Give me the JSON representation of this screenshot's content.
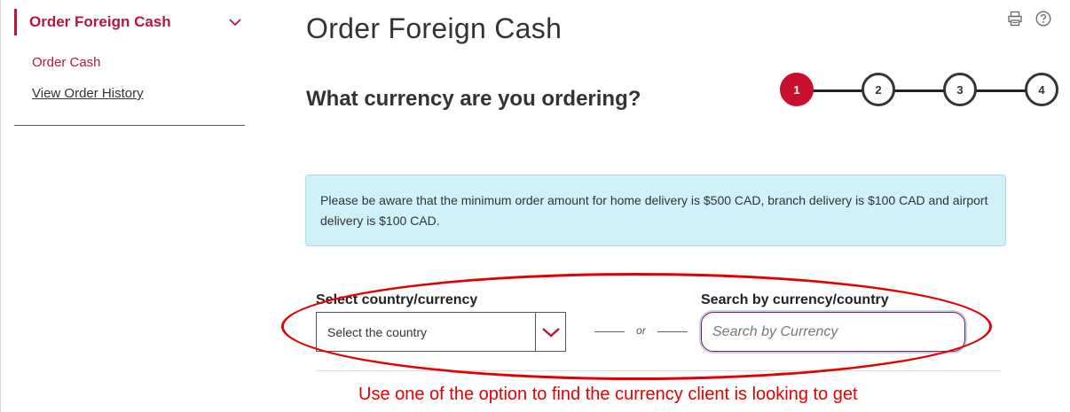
{
  "sidebar": {
    "section_title": "Order Foreign Cash",
    "links": [
      {
        "label": "Order Cash"
      },
      {
        "label": "View Order History"
      }
    ]
  },
  "header": {
    "title": "Order Foreign Cash",
    "tools": [
      {
        "icon": "print-icon"
      },
      {
        "icon": "help-icon"
      }
    ]
  },
  "step_question": "What currency are you ordering?",
  "stepper": {
    "current_step": 1,
    "steps": [
      {
        "label": "1",
        "active": true
      },
      {
        "label": "2",
        "active": false
      },
      {
        "label": "3",
        "active": false
      },
      {
        "label": "4",
        "active": false
      }
    ]
  },
  "notice": {
    "text": "Please be aware that the minimum order amount for home delivery is $500 CAD, branch delivery is $100 CAD and airport delivery is $100 CAD."
  },
  "form": {
    "country_label": "Select country/currency",
    "country_select_value": "Select the country",
    "or_text": "or",
    "search_label": "Search by currency/country",
    "search_placeholder": "Search by Currency",
    "search_value": ""
  },
  "annotation": {
    "text": "Use one of the option to find the currency client is looking to get",
    "color": "#e30000"
  },
  "colors": {
    "brand": "#b7163b",
    "active_step": "#c8102e",
    "notice_bg": "#d1f1f8"
  }
}
